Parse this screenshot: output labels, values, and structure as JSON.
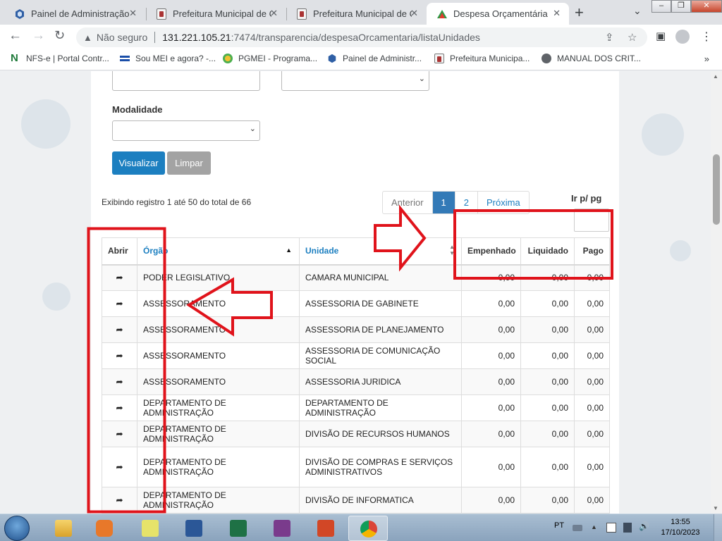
{
  "browser": {
    "tabs": [
      {
        "title": "Painel de Administração",
        "favicon": "hex-blue-icon",
        "active": false
      },
      {
        "title": "Prefeitura Municipal de C",
        "favicon": "city-seal-icon",
        "active": false
      },
      {
        "title": "Prefeitura Municipal de C",
        "favicon": "city-seal-icon",
        "active": false
      },
      {
        "title": "Despesa Orçamentária",
        "favicon": "triangle-logo-icon",
        "active": true
      }
    ],
    "close_glyph": "✕",
    "new_tab_glyph": "+",
    "address": {
      "security_text": "Não seguro",
      "host": "131.221.105.21",
      "path": ":7474/transparencia/despesaOrcamentaria/listaUnidades"
    },
    "bookmarks": [
      {
        "label": "NFS-e | Portal Contr...",
        "icon": "nfse-icon"
      },
      {
        "label": "Sou MEI e agora? -...",
        "icon": "mei-flag-icon"
      },
      {
        "label": "PGMEI - Programa...",
        "icon": "pgmei-icon"
      },
      {
        "label": "Painel de Administr...",
        "icon": "hex-blue-icon"
      },
      {
        "label": "Prefeitura Municipa...",
        "icon": "city-seal-icon"
      },
      {
        "label": "MANUAL DOS CRIT...",
        "icon": "globe-icon"
      }
    ],
    "bookmarks_more": "»"
  },
  "filters": {
    "modalidade_label": "Modalidade",
    "visualizar_label": "Visualizar",
    "limpar_label": "Limpar"
  },
  "summary": "Exibindo registro 1 até 50 do total de 66",
  "pagination": {
    "prev": "Anterior",
    "pages": [
      "1",
      "2"
    ],
    "active_page": "1",
    "next": "Próxima"
  },
  "goto_label": "Ir p/ pg",
  "table": {
    "headers": {
      "abrir": "Abrir",
      "orgao": "Órgão",
      "unidade": "Unidade",
      "empenhado": "Empenhado",
      "liquidado": "Liquidado",
      "pago": "Pago"
    },
    "rows": [
      {
        "orgao": "PODER LEGISLATIVO",
        "unidade": "CAMARA MUNICIPAL",
        "empenhado": "0,00",
        "liquidado": "0,00",
        "pago": "0,00"
      },
      {
        "orgao": "ASSESSORAMENTO",
        "unidade": "ASSESSORIA DE GABINETE",
        "empenhado": "0,00",
        "liquidado": "0,00",
        "pago": "0,00"
      },
      {
        "orgao": "ASSESSORAMENTO",
        "unidade": "ASSESSORIA DE PLANEJAMENTO",
        "empenhado": "0,00",
        "liquidado": "0,00",
        "pago": "0,00"
      },
      {
        "orgao": "ASSESSORAMENTO",
        "unidade": "ASSESSORIA DE COMUNICAÇÃO SOCIAL",
        "empenhado": "0,00",
        "liquidado": "0,00",
        "pago": "0,00"
      },
      {
        "orgao": "ASSESSORAMENTO",
        "unidade": "ASSESSORIA JURIDICA",
        "empenhado": "0,00",
        "liquidado": "0,00",
        "pago": "0,00"
      },
      {
        "orgao": "DEPARTAMENTO DE ADMINISTRAÇÃO",
        "unidade": "DEPARTAMENTO DE ADMINISTRAÇÃO",
        "empenhado": "0,00",
        "liquidado": "0,00",
        "pago": "0,00"
      },
      {
        "orgao": "DEPARTAMENTO DE ADMINISTRAÇÃO",
        "unidade": "DIVISÃO DE RECURSOS HUMANOS",
        "empenhado": "0,00",
        "liquidado": "0,00",
        "pago": "0,00"
      },
      {
        "orgao": "DEPARTAMENTO DE ADMINISTRAÇÃO",
        "unidade": "DIVISÃO DE COMPRAS E SERVIÇOS ADMINISTRATIVOS",
        "empenhado": "0,00",
        "liquidado": "0,00",
        "pago": "0,00"
      },
      {
        "orgao": "DEPARTAMENTO DE ADMINISTRAÇÃO",
        "unidade": "DIVISÃO DE INFORMATICA",
        "empenhado": "0,00",
        "liquidado": "0,00",
        "pago": "0,00"
      }
    ]
  },
  "annotation_color": "#e0131b",
  "taskbar": {
    "apps": [
      "explorer-icon",
      "media-player-icon",
      "sticky-notes-icon",
      "word-icon",
      "excel-icon",
      "onenote-icon",
      "powerpoint-icon",
      "chrome-icon"
    ],
    "language": "PT",
    "time": "13:55",
    "date": "17/10/2023"
  }
}
